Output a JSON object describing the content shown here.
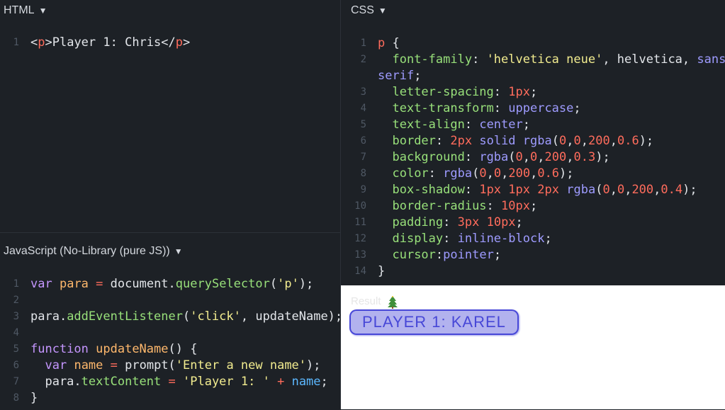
{
  "html_pane": {
    "header": "HTML",
    "lines": [
      {
        "n": "1",
        "parts": [
          [
            "",
            "<"
          ],
          [
            "tag",
            "p"
          ],
          [
            "",
            ">Player 1: Chris</"
          ],
          [
            "tag",
            "p"
          ],
          [
            "",
            ">"
          ]
        ]
      }
    ]
  },
  "css_pane": {
    "header": "CSS",
    "lines": [
      {
        "n": "1",
        "parts": [
          [
            "tag",
            "p"
          ],
          [
            "",
            " {"
          ]
        ]
      },
      {
        "n": "2",
        "parts": [
          [
            "",
            "  "
          ],
          [
            "prop",
            "font-family"
          ],
          [
            "",
            ": "
          ],
          [
            "str",
            "'helvetica neue'"
          ],
          [
            "",
            ", helvetica, "
          ],
          [
            "val",
            "sans-"
          ]
        ]
      },
      {
        "n": "",
        "parts": [
          [
            "val",
            "serif"
          ],
          [
            "",
            ";"
          ]
        ]
      },
      {
        "n": "3",
        "parts": [
          [
            "",
            "  "
          ],
          [
            "prop",
            "letter-spacing"
          ],
          [
            "",
            ": "
          ],
          [
            "num",
            "1px"
          ],
          [
            "",
            ";"
          ]
        ]
      },
      {
        "n": "4",
        "parts": [
          [
            "",
            "  "
          ],
          [
            "prop",
            "text-transform"
          ],
          [
            "",
            ": "
          ],
          [
            "val",
            "uppercase"
          ],
          [
            "",
            ";"
          ]
        ]
      },
      {
        "n": "5",
        "parts": [
          [
            "",
            "  "
          ],
          [
            "prop",
            "text-align"
          ],
          [
            "",
            ": "
          ],
          [
            "val",
            "center"
          ],
          [
            "",
            ";"
          ]
        ]
      },
      {
        "n": "6",
        "parts": [
          [
            "",
            "  "
          ],
          [
            "prop",
            "border"
          ],
          [
            "",
            ": "
          ],
          [
            "num",
            "2px"
          ],
          [
            "",
            " "
          ],
          [
            "val",
            "solid"
          ],
          [
            "",
            " "
          ],
          [
            "val",
            "rgba"
          ],
          [
            "",
            "("
          ],
          [
            "num",
            "0"
          ],
          [
            "",
            ","
          ],
          [
            "num",
            "0"
          ],
          [
            "",
            ","
          ],
          [
            "num",
            "200"
          ],
          [
            "",
            ","
          ],
          [
            "num",
            "0.6"
          ],
          [
            "",
            ");"
          ]
        ]
      },
      {
        "n": "7",
        "parts": [
          [
            "",
            "  "
          ],
          [
            "prop",
            "background"
          ],
          [
            "",
            ": "
          ],
          [
            "val",
            "rgba"
          ],
          [
            "",
            "("
          ],
          [
            "num",
            "0"
          ],
          [
            "",
            ","
          ],
          [
            "num",
            "0"
          ],
          [
            "",
            ","
          ],
          [
            "num",
            "200"
          ],
          [
            "",
            ","
          ],
          [
            "num",
            "0.3"
          ],
          [
            "",
            ");"
          ]
        ]
      },
      {
        "n": "8",
        "parts": [
          [
            "",
            "  "
          ],
          [
            "prop",
            "color"
          ],
          [
            "",
            ": "
          ],
          [
            "val",
            "rgba"
          ],
          [
            "",
            "("
          ],
          [
            "num",
            "0"
          ],
          [
            "",
            ","
          ],
          [
            "num",
            "0"
          ],
          [
            "",
            ","
          ],
          [
            "num",
            "200"
          ],
          [
            "",
            ","
          ],
          [
            "num",
            "0.6"
          ],
          [
            "",
            ");"
          ]
        ]
      },
      {
        "n": "9",
        "parts": [
          [
            "",
            "  "
          ],
          [
            "prop",
            "box-shadow"
          ],
          [
            "",
            ": "
          ],
          [
            "num",
            "1px"
          ],
          [
            "",
            " "
          ],
          [
            "num",
            "1px"
          ],
          [
            "",
            " "
          ],
          [
            "num",
            "2px"
          ],
          [
            "",
            " "
          ],
          [
            "val",
            "rgba"
          ],
          [
            "",
            "("
          ],
          [
            "num",
            "0"
          ],
          [
            "",
            ","
          ],
          [
            "num",
            "0"
          ],
          [
            "",
            ","
          ],
          [
            "num",
            "200"
          ],
          [
            "",
            ","
          ],
          [
            "num",
            "0.4"
          ],
          [
            "",
            ");"
          ]
        ]
      },
      {
        "n": "10",
        "parts": [
          [
            "",
            "  "
          ],
          [
            "prop",
            "border-radius"
          ],
          [
            "",
            ": "
          ],
          [
            "num",
            "10px"
          ],
          [
            "",
            ";"
          ]
        ]
      },
      {
        "n": "11",
        "parts": [
          [
            "",
            "  "
          ],
          [
            "prop",
            "padding"
          ],
          [
            "",
            ": "
          ],
          [
            "num",
            "3px"
          ],
          [
            "",
            " "
          ],
          [
            "num",
            "10px"
          ],
          [
            "",
            ";"
          ]
        ]
      },
      {
        "n": "12",
        "parts": [
          [
            "",
            "  "
          ],
          [
            "prop",
            "display"
          ],
          [
            "",
            ": "
          ],
          [
            "val",
            "inline-block"
          ],
          [
            "",
            ";"
          ]
        ]
      },
      {
        "n": "13",
        "parts": [
          [
            "",
            "  "
          ],
          [
            "prop",
            "cursor"
          ],
          [
            "",
            ":"
          ],
          [
            "val",
            "pointer"
          ],
          [
            "",
            ";"
          ]
        ]
      },
      {
        "n": "14",
        "parts": [
          [
            "",
            "}"
          ]
        ]
      }
    ]
  },
  "js_pane": {
    "header": "JavaScript (No-Library (pure JS))",
    "lines": [
      {
        "n": "1",
        "parts": [
          [
            "kw",
            "var"
          ],
          [
            "",
            " "
          ],
          [
            "var",
            "para"
          ],
          [
            "",
            " "
          ],
          [
            "op",
            "="
          ],
          [
            "",
            " document."
          ],
          [
            "fn",
            "querySelector"
          ],
          [
            "",
            "("
          ],
          [
            "str",
            "'p'"
          ],
          [
            "",
            ");"
          ]
        ]
      },
      {
        "n": "2",
        "parts": [
          [
            "",
            ""
          ]
        ]
      },
      {
        "n": "3",
        "parts": [
          [
            "",
            "para."
          ],
          [
            "fn",
            "addEventListener"
          ],
          [
            "",
            "("
          ],
          [
            "str",
            "'click'"
          ],
          [
            "",
            ", updateName);"
          ]
        ]
      },
      {
        "n": "4",
        "parts": [
          [
            "",
            ""
          ]
        ]
      },
      {
        "n": "5",
        "parts": [
          [
            "kw",
            "function"
          ],
          [
            "",
            " "
          ],
          [
            "var",
            "updateName"
          ],
          [
            "",
            "() {"
          ]
        ]
      },
      {
        "n": "6",
        "parts": [
          [
            "",
            "  "
          ],
          [
            "kw",
            "var"
          ],
          [
            "",
            " "
          ],
          [
            "var",
            "name"
          ],
          [
            "",
            " "
          ],
          [
            "op",
            "="
          ],
          [
            "",
            " prompt("
          ],
          [
            "str",
            "'Enter a new name'"
          ],
          [
            "",
            ");"
          ]
        ]
      },
      {
        "n": "7",
        "parts": [
          [
            "",
            "  para."
          ],
          [
            "fn",
            "textContent"
          ],
          [
            "",
            " "
          ],
          [
            "op",
            "="
          ],
          [
            "",
            " "
          ],
          [
            "str",
            "'Player 1: '"
          ],
          [
            "",
            " "
          ],
          [
            "op",
            "+"
          ],
          [
            "",
            " "
          ],
          [
            "blue",
            "name"
          ],
          [
            "",
            ";"
          ]
        ]
      },
      {
        "n": "8",
        "parts": [
          [
            "",
            "}"
          ]
        ]
      }
    ]
  },
  "result_pane": {
    "label": "Result",
    "badge_text": "Player 1: Karel"
  },
  "colors": {
    "editor_bg": "#1d2126",
    "result_bg": "#ffffff",
    "badge_border": "rgba(0,0,200,0.6)",
    "badge_bg": "rgba(0,0,200,0.3)"
  },
  "icons": {
    "caret": "triangle-down-icon",
    "result_tree": "christmas-tree-icon"
  }
}
